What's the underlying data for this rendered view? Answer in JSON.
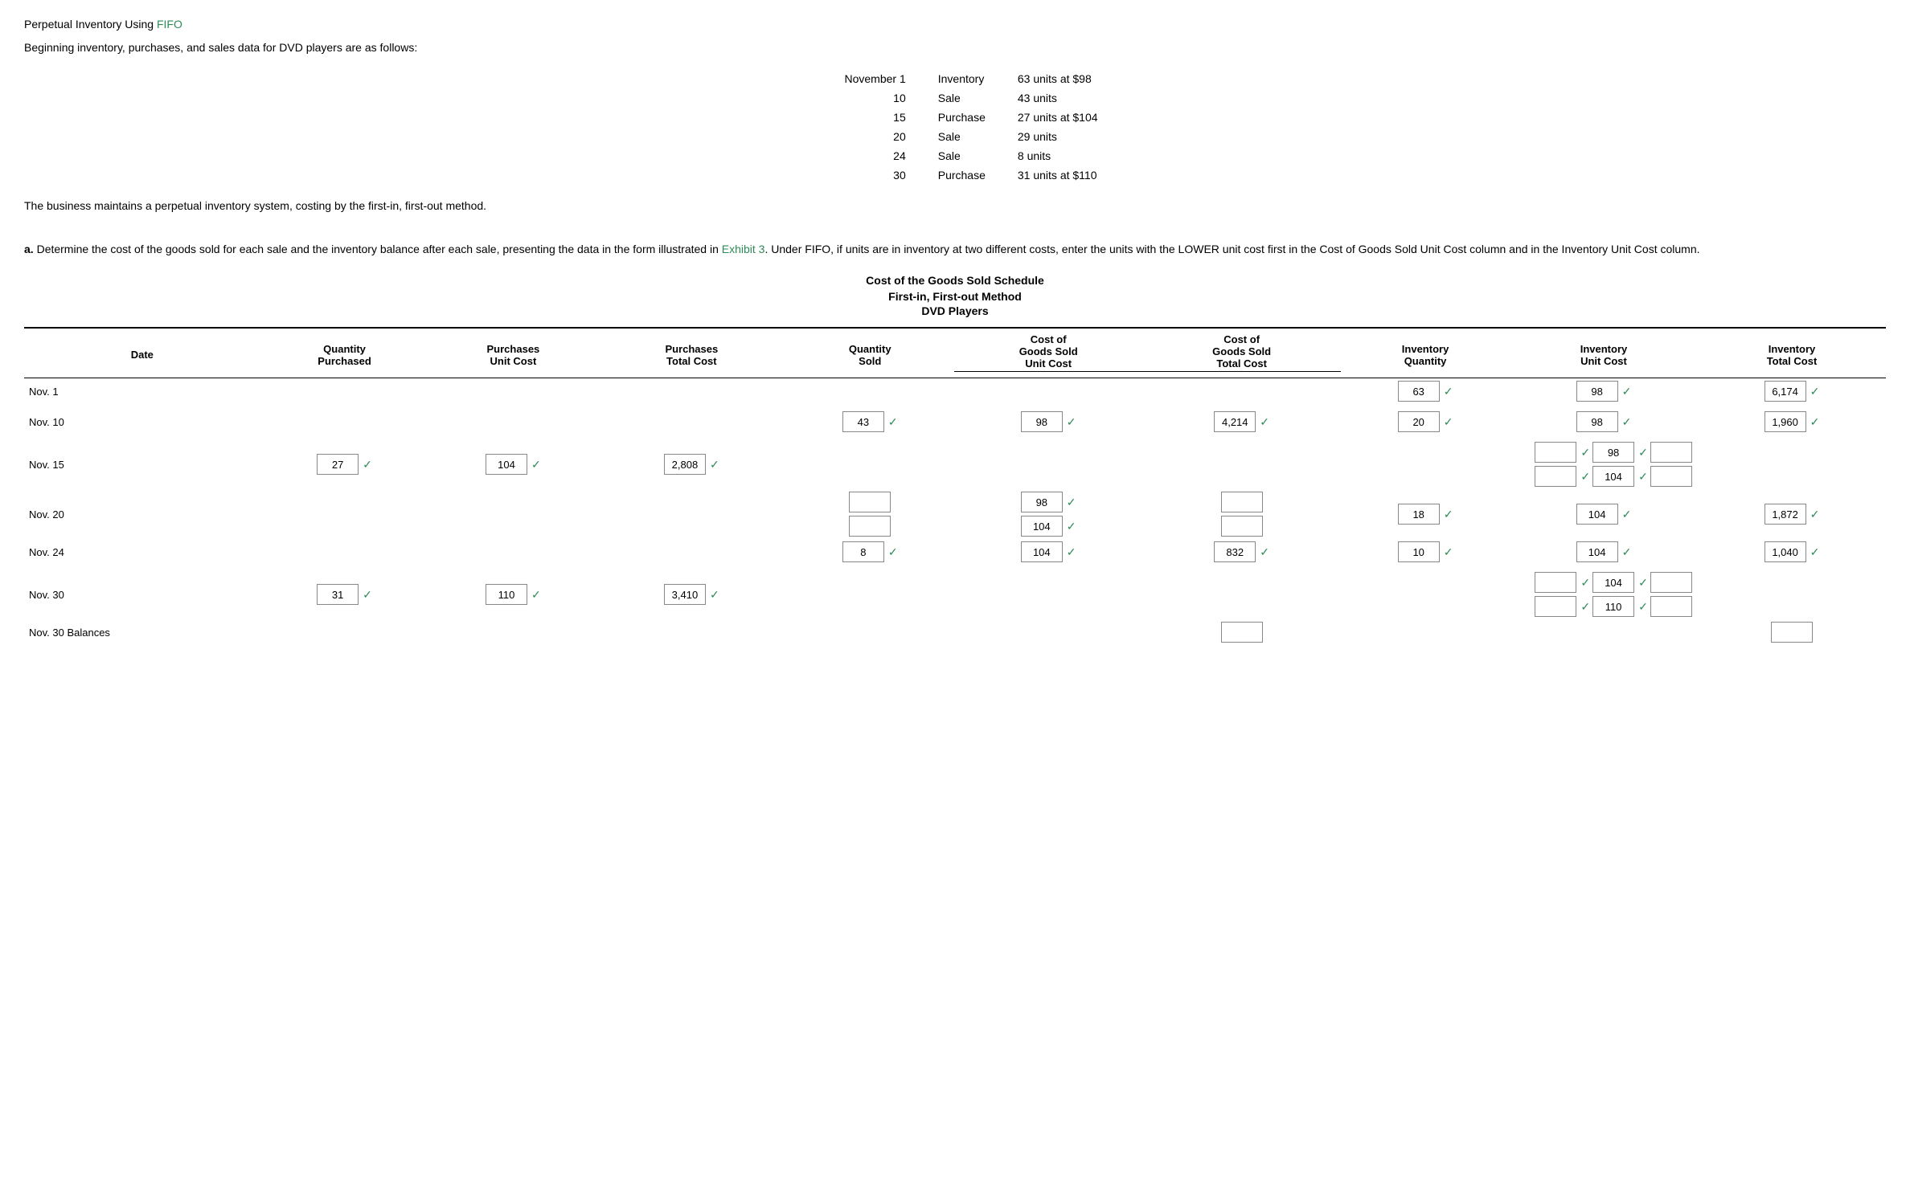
{
  "title": "Perpetual Inventory Using FIFO",
  "link_text": "FIFO",
  "intro": "Beginning inventory, purchases, and sales data for DVD players are as follows:",
  "inventory_data": [
    {
      "date": "November 1",
      "type": "Inventory",
      "detail": "63 units at $98"
    },
    {
      "date": "10",
      "type": "Sale",
      "detail": "43 units"
    },
    {
      "date": "15",
      "type": "Purchase",
      "detail": "27 units at $104"
    },
    {
      "date": "20",
      "type": "Sale",
      "detail": "29 units"
    },
    {
      "date": "24",
      "type": "Sale",
      "detail": "8 units"
    },
    {
      "date": "30",
      "type": "Purchase",
      "detail": "31 units at $110"
    }
  ],
  "perpetual_note": "The business maintains a perpetual inventory system, costing by the first-in, first-out method.",
  "instruction": "a. Determine the cost of the goods sold for each sale and the inventory balance after each sale, presenting the data in the form illustrated in Exhibit 3. Under FIFO, if units are in inventory at two different costs, enter the units with the LOWER unit cost first in the Cost of Goods Sold Unit Cost column and in the Inventory Unit Cost column.",
  "exhibit_link": "Exhibit 3",
  "schedule_title": "Cost of the Goods Sold Schedule",
  "schedule_subtitle": "First-in, First-out Method",
  "schedule_sub2": "DVD Players",
  "headers": {
    "date": "Date",
    "qty_purchased": "Quantity Purchased",
    "purch_unit_cost": "Purchases Unit Cost",
    "purch_total_cost": "Purchases Total Cost",
    "qty_sold": "Quantity Sold",
    "cogs_unit_cost": "Cost of Goods Sold Unit Cost",
    "cogs_total_cost": "Cost of Goods Sold Total Cost",
    "inv_qty": "Inventory Quantity",
    "inv_unit_cost": "Inventory Unit Cost",
    "inv_total_cost": "Inventory Total Cost"
  },
  "rows": [
    {
      "date": "Nov. 1",
      "qty_purchased": "",
      "purch_unit_cost": "",
      "purch_total_cost": "",
      "qty_sold": "",
      "cogs_unit_cost": "",
      "cogs_total_cost": "",
      "inv_qty": "63",
      "inv_unit_cost": "98",
      "inv_total_cost": "6,174",
      "checks": {
        "inv_qty": true,
        "inv_unit_cost": true,
        "inv_total_cost": true
      }
    },
    {
      "date": "Nov. 10",
      "qty_purchased": "",
      "purch_unit_cost": "",
      "purch_total_cost": "",
      "qty_sold": "43",
      "cogs_unit_cost": "98",
      "cogs_total_cost": "4,214",
      "inv_qty": "20",
      "inv_unit_cost": "98",
      "inv_total_cost": "1,960",
      "checks": {
        "qty_sold": true,
        "cogs_unit_cost": true,
        "cogs_total_cost": true,
        "inv_qty": true,
        "inv_unit_cost": true,
        "inv_total_cost": true
      }
    },
    {
      "date": "Nov. 15",
      "qty_purchased": "27",
      "purch_unit_cost": "104",
      "purch_total_cost": "2,808",
      "qty_sold": "",
      "cogs_unit_cost": "",
      "cogs_total_cost": "",
      "inv_rows": [
        {
          "qty": "",
          "unit_cost": "98",
          "total": ""
        },
        {
          "qty": "",
          "unit_cost": "104",
          "total": ""
        }
      ],
      "checks": {
        "qty_purchased": true,
        "purch_unit_cost": true,
        "purch_total_cost": true,
        "inv_unit_cost_1": true,
        "inv_unit_cost_2": true
      }
    },
    {
      "date": "Nov. 20",
      "qty_purchased": "",
      "purch_unit_cost": "",
      "purch_total_cost": "",
      "sold_rows": [
        {
          "qty": "",
          "unit_cost": "98",
          "total": ""
        },
        {
          "qty": "",
          "unit_cost": "104",
          "total": ""
        }
      ],
      "inv_qty": "18",
      "inv_unit_cost": "104",
      "inv_total_cost": "1,872",
      "checks": {
        "cogs_unit_cost_1": true,
        "cogs_unit_cost_2": true,
        "inv_qty": true,
        "inv_unit_cost": true,
        "inv_total_cost": true
      }
    },
    {
      "date": "Nov. 24",
      "qty_purchased": "",
      "purch_unit_cost": "",
      "purch_total_cost": "",
      "qty_sold": "8",
      "cogs_unit_cost": "104",
      "cogs_total_cost": "832",
      "inv_qty": "10",
      "inv_unit_cost": "104",
      "inv_total_cost": "1,040",
      "checks": {
        "qty_sold": true,
        "cogs_unit_cost": true,
        "cogs_total_cost": true,
        "inv_qty": true,
        "inv_unit_cost": true,
        "inv_total_cost": true
      }
    },
    {
      "date": "Nov. 30",
      "qty_purchased": "31",
      "purch_unit_cost": "110",
      "purch_total_cost": "3,410",
      "qty_sold": "",
      "cogs_unit_cost": "",
      "cogs_total_cost": "",
      "inv_rows": [
        {
          "qty": "",
          "unit_cost": "104",
          "total": ""
        },
        {
          "qty": "",
          "unit_cost": "110",
          "total": ""
        }
      ],
      "checks": {
        "qty_purchased": true,
        "purch_unit_cost": true,
        "purch_total_cost": true,
        "inv_unit_cost_1": true,
        "inv_unit_cost_2": true
      }
    },
    {
      "date": "Nov. 30 Balances",
      "is_balance": true,
      "cogs_total_balance": "",
      "inv_total_balance": ""
    }
  ],
  "check_symbol": "✓",
  "colors": {
    "link": "#2e8b57",
    "check": "#2e8b57"
  }
}
